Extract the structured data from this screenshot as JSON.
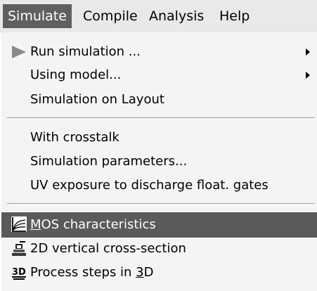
{
  "menubar": {
    "items": [
      {
        "label": "Simulate"
      },
      {
        "label": "Compile"
      },
      {
        "label": "Analysis"
      },
      {
        "label": "Help"
      }
    ]
  },
  "menu": {
    "run_simulation": "Run simulation ...",
    "using_model": "Using model...",
    "simulation_on_layout": "Simulation on Layout",
    "with_crosstalk": "With crosstalk",
    "simulation_parameters": "Simulation parameters...",
    "uv_exposure": "UV exposure to discharge float. gates",
    "mos_accel": "M",
    "mos_rest": "OS characteristics",
    "vertical_cross_section": "2D vertical cross-section",
    "process_steps_prefix": "Process steps in ",
    "process_steps_accel": "3",
    "process_steps_suffix": "D"
  },
  "icons": {
    "run": "play-triangle-icon",
    "mos": "mos-curves-icon",
    "cross_section": "cross-section-icon",
    "process_3d": "3d-icon"
  },
  "colors": {
    "active_menu_bg": "#5f5f5f",
    "highlight_bg": "#5a5a5a",
    "menu_bg": "#f4f4f4",
    "menubar_bg": "#e9e9e9"
  }
}
